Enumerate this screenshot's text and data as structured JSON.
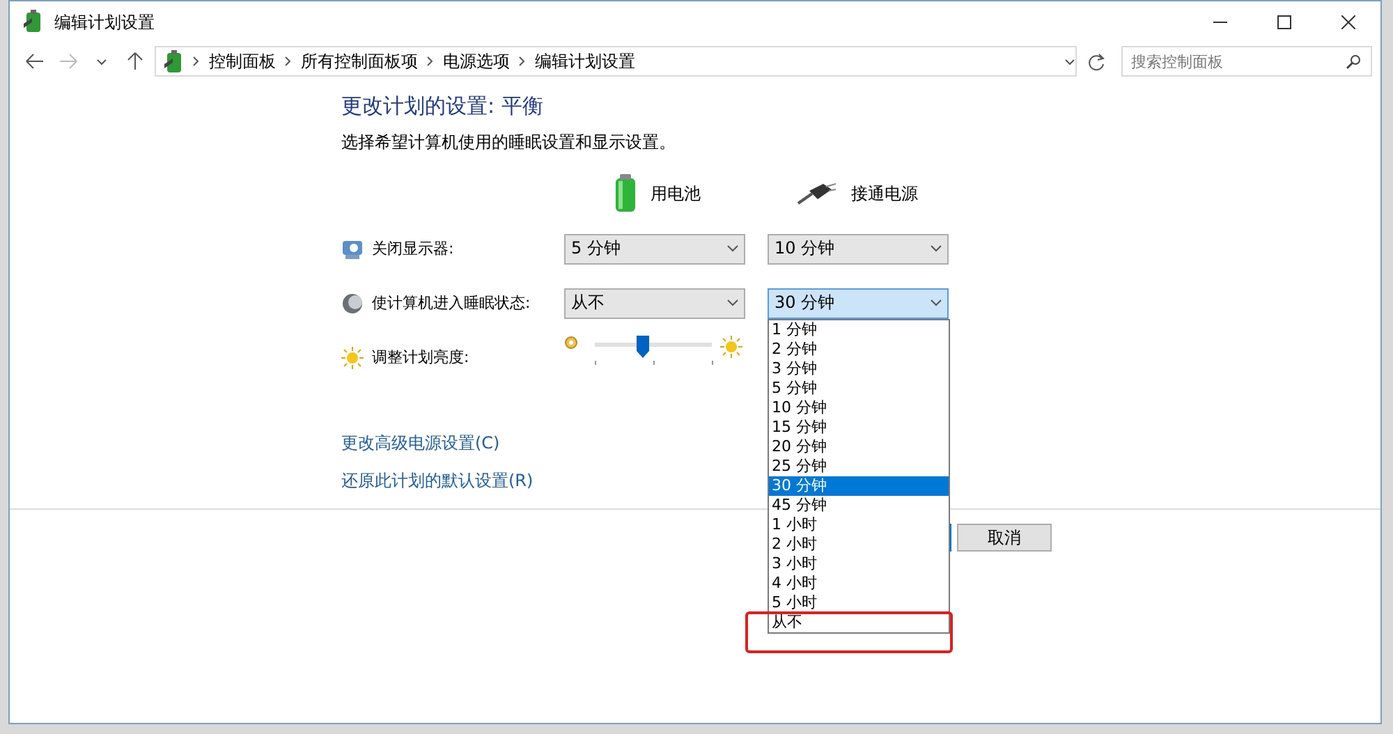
{
  "window": {
    "title": "编辑计划设置"
  },
  "address_bar": {
    "breadcrumbs": [
      "控制面板",
      "所有控制面板项",
      "电源选项",
      "编辑计划设置"
    ]
  },
  "search": {
    "placeholder": "搜索控制面板"
  },
  "heading": "更改计划的设置: 平衡",
  "description": "选择希望计算机使用的睡眠设置和显示设置。",
  "columns": [
    {
      "label": "用电池",
      "kind": "battery"
    },
    {
      "label": "接通电源",
      "kind": "plug"
    }
  ],
  "settings": [
    {
      "kind": "dropdowns",
      "label": "关闭显示器:",
      "values": [
        {
          "value": "5 分钟",
          "expanded": false
        },
        {
          "value": "10 分钟",
          "expanded": false
        }
      ]
    },
    {
      "kind": "dropdowns",
      "label": "使计算机进入睡眠状态:",
      "values": [
        {
          "value": "从不",
          "expanded": false
        },
        {
          "value": "30 分钟",
          "expanded": true,
          "options": [
            {
              "label": "1 分钟",
              "selected": false
            },
            {
              "label": "2 分钟",
              "selected": false
            },
            {
              "label": "3 分钟",
              "selected": false
            },
            {
              "label": "5 分钟",
              "selected": false
            },
            {
              "label": "10 分钟",
              "selected": false
            },
            {
              "label": "15 分钟",
              "selected": false
            },
            {
              "label": "20 分钟",
              "selected": false
            },
            {
              "label": "25 分钟",
              "selected": false
            },
            {
              "label": "30 分钟",
              "selected": true
            },
            {
              "label": "45 分钟",
              "selected": false
            },
            {
              "label": "1 小时",
              "selected": false
            },
            {
              "label": "2 小时",
              "selected": false
            },
            {
              "label": "3 小时",
              "selected": false
            },
            {
              "label": "4 小时",
              "selected": false
            },
            {
              "label": "5 小时",
              "selected": false
            },
            {
              "label": "从不",
              "selected": false
            }
          ]
        }
      ]
    },
    {
      "kind": "slider",
      "label": "调整计划亮度:",
      "level": 0.4
    }
  ],
  "links": [
    "更改高级电源设置(C)",
    "还原此计划的默认设置(R)"
  ],
  "buttons": [
    {
      "kind": "default"
    },
    {
      "kind": "normal",
      "label": "取消"
    }
  ],
  "annotation": {
    "kind": "rectangle"
  }
}
